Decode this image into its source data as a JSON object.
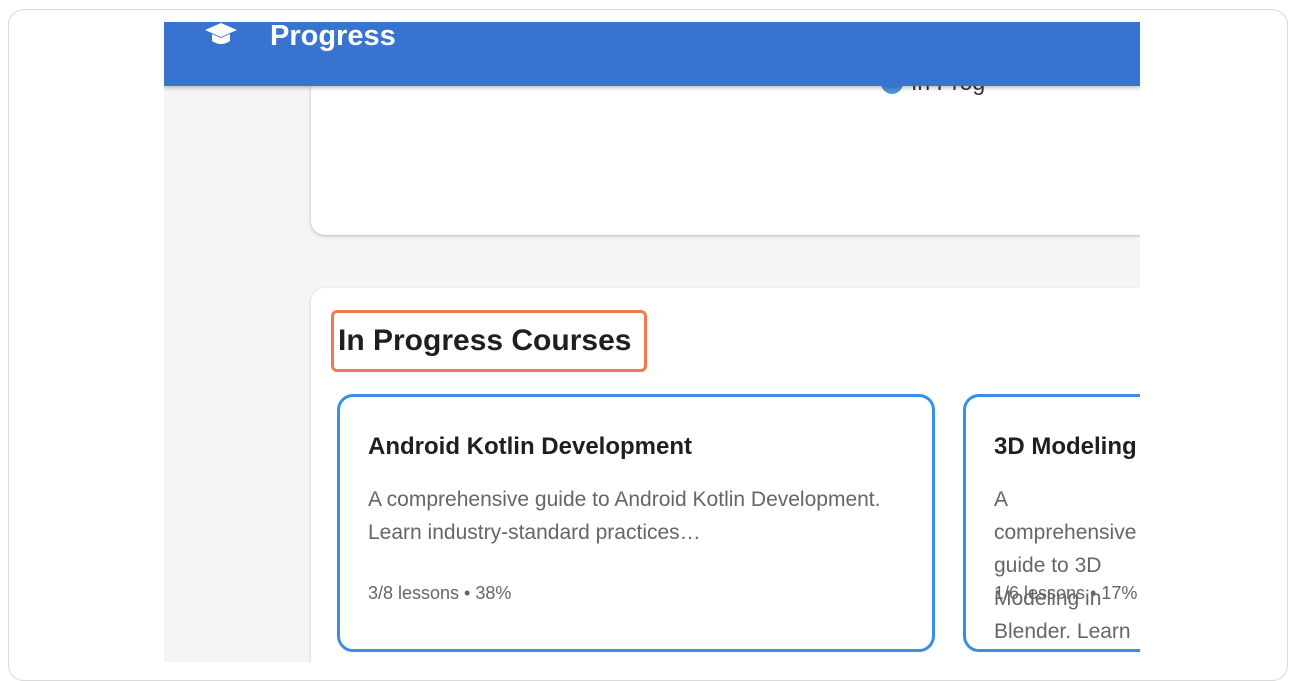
{
  "appbar": {
    "icon": "graduation-cap-icon",
    "title": "Progress"
  },
  "chart_card": {
    "legend": [
      {
        "label": "In Prog",
        "color": "#4a90e2"
      }
    ]
  },
  "in_progress": {
    "section_title": "In Progress Courses",
    "courses": [
      {
        "title": "Android Kotlin Development",
        "description": "A comprehensive guide to Android Kotlin Development. Learn industry-standard practices…",
        "meta": "3/8 lessons • 38%"
      },
      {
        "title": "3D Modeling",
        "description": "A comprehensive guide to 3D Modeling in Blender. Learn",
        "meta": "1/6 lessons • 17%"
      }
    ]
  },
  "colors": {
    "appbar": "#3874cf",
    "highlight": "#ec7b4f",
    "card_border": "#3a8ee6"
  }
}
